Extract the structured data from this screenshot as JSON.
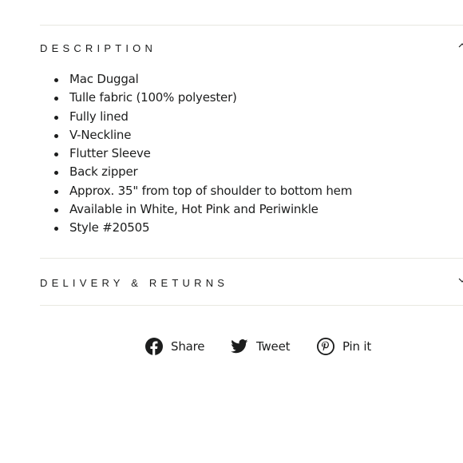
{
  "sections": {
    "description": {
      "title": "DESCRIPTION",
      "items": [
        "Mac Duggal",
        "Tulle fabric (100% polyester)",
        "Fully lined",
        "V-Neckline",
        "Flutter Sleeve",
        "Back zipper",
        "Approx. 35\" from top of shoulder to bottom hem",
        "Available in White, Hot Pink and Periwinkle",
        "Style #20505"
      ]
    },
    "delivery": {
      "title": "DELIVERY & RETURNS"
    }
  },
  "social": {
    "facebook": {
      "label": "Share",
      "icon": "facebook-icon"
    },
    "twitter": {
      "label": "Tweet",
      "icon": "twitter-icon"
    },
    "pinterest": {
      "label": "Pin it",
      "icon": "pinterest-icon"
    }
  }
}
